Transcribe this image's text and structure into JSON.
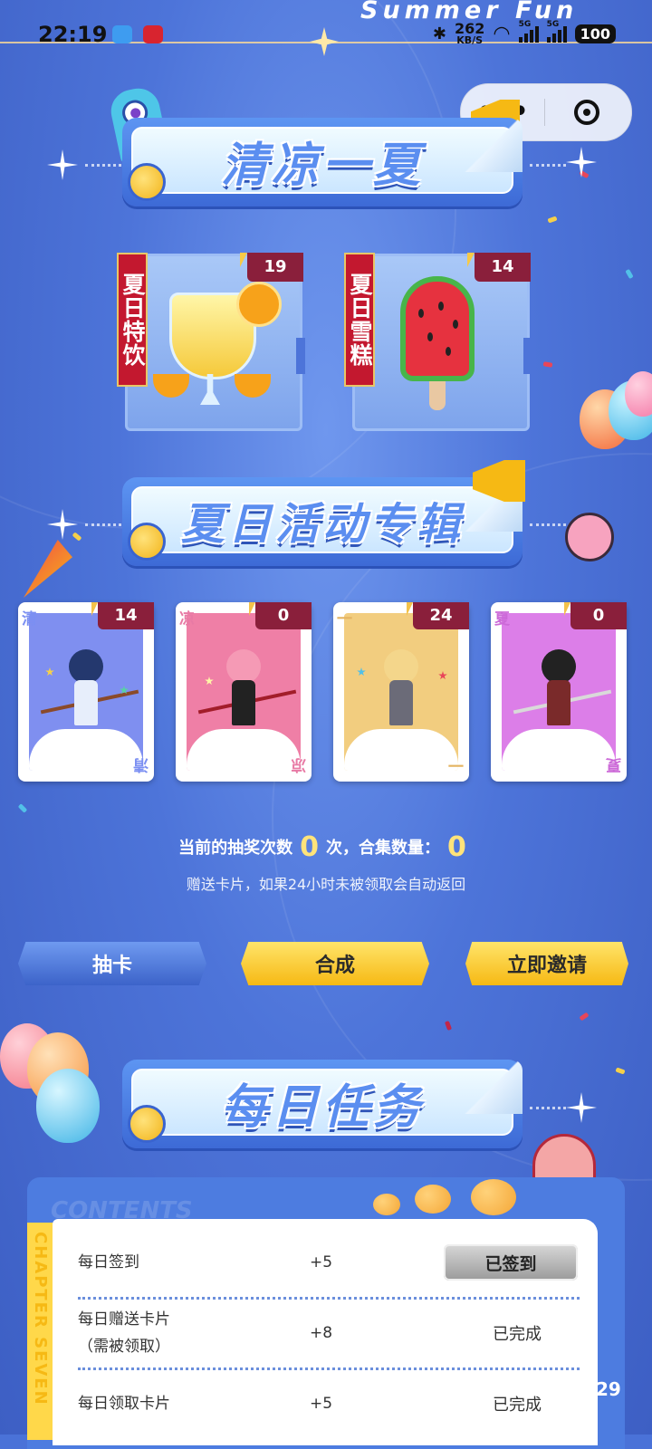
{
  "status_bar": {
    "time": "22:19",
    "net_speed": "262",
    "net_unit": "KB/S",
    "sim1": "5G",
    "sim2": "5G",
    "battery": "100"
  },
  "header": {
    "title": "Summer Fun"
  },
  "capsule": {
    "more_icon": "more-dots-icon",
    "close_icon": "target-close-icon"
  },
  "banners": {
    "top": "清凉一夏",
    "activities": "夏日活动专辑",
    "tasks": "每日任务"
  },
  "drinks": [
    {
      "tag": "夏日特饮",
      "count": "19"
    },
    {
      "tag": "夏日雪糕",
      "count": "14"
    }
  ],
  "cards": [
    {
      "char": "清",
      "count": "14",
      "bg": "#7f8ff0",
      "color": "#7b8ff2"
    },
    {
      "char": "凉",
      "count": "0",
      "bg": "#ef7fa6",
      "color": "#e87aa5"
    },
    {
      "char": "一",
      "count": "24",
      "bg": "#f2cd7f",
      "color": "#e4b462"
    },
    {
      "char": "夏",
      "count": "0",
      "bg": "#dc7ee8",
      "color": "#cc6ad8"
    }
  ],
  "info": {
    "draws_label": "当前的抽奖次数",
    "draws_value": "0",
    "draws_unit": "次，合集数量：",
    "collection_value": "0",
    "note": "赠送卡片，如果24小时未被领取会自动返回"
  },
  "buttons": {
    "draw": "抽卡",
    "combine": "合成",
    "invite": "立即邀请"
  },
  "tasks_panel": {
    "side_label": "CHAPTER SEVEN",
    "tab_label": "CONTENTS",
    "rows": [
      {
        "name": "每日签到",
        "sub": "",
        "points": "+5",
        "status": "已签到",
        "is_button": true
      },
      {
        "name": "每日赠送卡片",
        "sub": "（需被领取）",
        "points": "+8",
        "status": "已完成",
        "is_button": false
      },
      {
        "name": "每日领取卡片",
        "sub": "",
        "points": "+5",
        "status": "已完成",
        "is_button": false
      }
    ]
  },
  "page_number": "29"
}
